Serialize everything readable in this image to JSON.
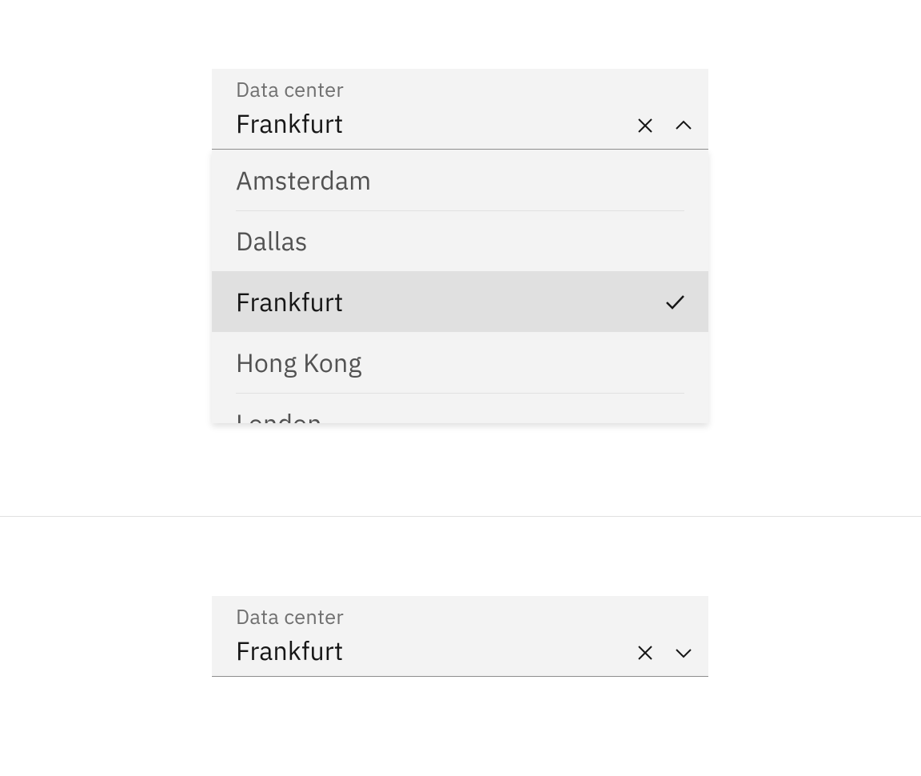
{
  "open": {
    "label": "Data center",
    "selected": "Frankfurt",
    "options": [
      {
        "label": "Amsterdam",
        "selected": false
      },
      {
        "label": "Dallas",
        "selected": false
      },
      {
        "label": "Frankfurt",
        "selected": true
      },
      {
        "label": "Hong Kong",
        "selected": false
      },
      {
        "label": "London",
        "selected": false
      }
    ]
  },
  "closed": {
    "label": "Data center",
    "selected": "Frankfurt"
  }
}
